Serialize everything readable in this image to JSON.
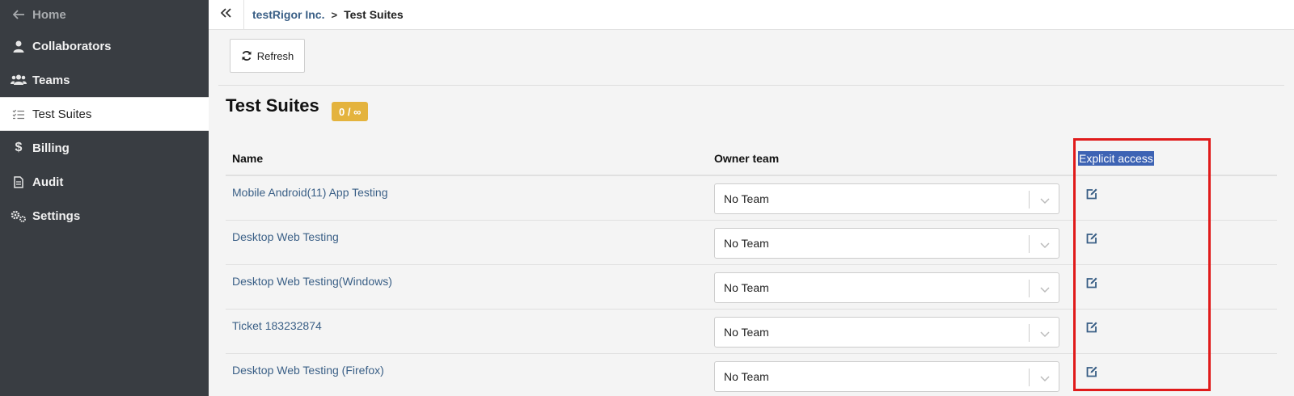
{
  "sidebar": {
    "items": [
      {
        "label": "Home",
        "icon": "arrow-left-icon"
      },
      {
        "label": "Collaborators",
        "icon": "user-icon"
      },
      {
        "label": "Teams",
        "icon": "users-icon"
      },
      {
        "label": "Test Suites",
        "icon": "list-check-icon",
        "active": true
      },
      {
        "label": "Billing",
        "icon": "dollar-icon"
      },
      {
        "label": "Audit",
        "icon": "document-icon"
      },
      {
        "label": "Settings",
        "icon": "gears-icon"
      }
    ]
  },
  "breadcrumb": {
    "org": "testRigor Inc.",
    "separator": ">",
    "current": "Test Suites"
  },
  "toolbar": {
    "refresh_label": "Refresh"
  },
  "page": {
    "title": "Test Suites",
    "badge": "0 / ∞"
  },
  "table": {
    "headers": {
      "name": "Name",
      "owner": "Owner team",
      "access": "Explicit access"
    },
    "rows": [
      {
        "name": "Mobile Android(11) App Testing",
        "owner": "No Team"
      },
      {
        "name": "Desktop Web Testing",
        "owner": "No Team"
      },
      {
        "name": "Desktop Web Testing(Windows)",
        "owner": "No Team"
      },
      {
        "name": "Ticket 183232874",
        "owner": "No Team"
      },
      {
        "name": "Desktop Web Testing (Firefox)",
        "owner": "No Team"
      }
    ]
  },
  "colors": {
    "sidebar_bg": "#393d42",
    "link": "#3a5f86",
    "badge": "#e4b33d",
    "highlight": "#e01a1a",
    "selection": "#3d63b4"
  }
}
